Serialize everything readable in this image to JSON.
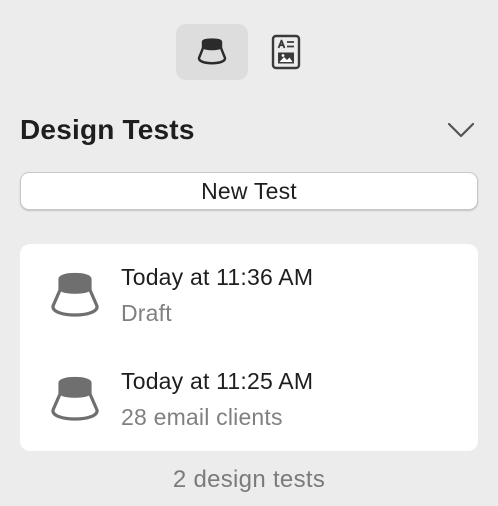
{
  "toolbar": {
    "tabs": [
      {
        "icon": "design-test-icon",
        "active": true
      },
      {
        "icon": "preview-document-icon",
        "active": false
      }
    ]
  },
  "section": {
    "title": "Design Tests",
    "collapse_icon": "chevron-down-icon"
  },
  "new_test": {
    "label": "New Test"
  },
  "tests": [
    {
      "icon": "design-test-icon",
      "title": "Today at 11:36 AM",
      "subtitle": "Draft"
    },
    {
      "icon": "design-test-icon",
      "title": "Today at 11:25 AM",
      "subtitle": "28 email clients"
    }
  ],
  "footer": {
    "count_label": "2 design tests"
  },
  "colors": {
    "background": "#ececec",
    "card": "#ffffff",
    "icon_gray": "#6f6f6f",
    "secondary_text": "#808080"
  }
}
